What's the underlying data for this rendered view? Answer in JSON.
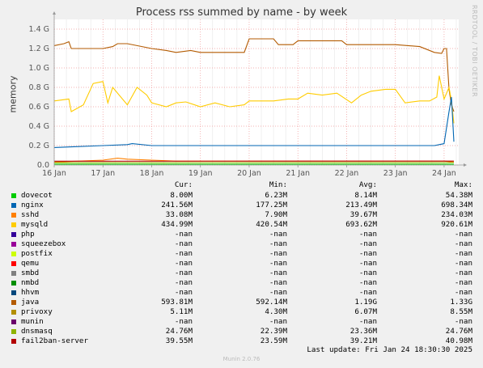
{
  "title": "Process rss summed by name - by week",
  "side_tag": "RRDTOOL / TOBI OETIKER",
  "footer": "Munin 2.0.76",
  "last_update": "Last update:  Fri Jan 24 18:30:30 2025",
  "headers": {
    "cur": "Cur:",
    "min": "Min:",
    "avg": "Avg:",
    "max": "Max:"
  },
  "legend": [
    {
      "name": "dovecot",
      "color": "#00cc00",
      "cur": "8.00M",
      "min": "6.23M",
      "avg": "8.14M",
      "max": "54.38M"
    },
    {
      "name": "nginx",
      "color": "#0066b3",
      "cur": "241.56M",
      "min": "177.25M",
      "avg": "213.49M",
      "max": "698.34M"
    },
    {
      "name": "sshd",
      "color": "#ff8000",
      "cur": "33.08M",
      "min": "7.90M",
      "avg": "39.67M",
      "max": "234.03M"
    },
    {
      "name": "mysqld",
      "color": "#ffcc00",
      "cur": "434.99M",
      "min": "420.54M",
      "avg": "693.62M",
      "max": "920.61M"
    },
    {
      "name": "php",
      "color": "#330099",
      "cur": "-nan",
      "min": "-nan",
      "avg": "-nan",
      "max": "-nan"
    },
    {
      "name": "squeezebox",
      "color": "#990099",
      "cur": "-nan",
      "min": "-nan",
      "avg": "-nan",
      "max": "-nan"
    },
    {
      "name": "postfix",
      "color": "#ccff00",
      "cur": "-nan",
      "min": "-nan",
      "avg": "-nan",
      "max": "-nan"
    },
    {
      "name": "qemu",
      "color": "#ff0000",
      "cur": "-nan",
      "min": "-nan",
      "avg": "-nan",
      "max": "-nan"
    },
    {
      "name": "smbd",
      "color": "#808080",
      "cur": "-nan",
      "min": "-nan",
      "avg": "-nan",
      "max": "-nan"
    },
    {
      "name": "nmbd",
      "color": "#008f00",
      "cur": "-nan",
      "min": "-nan",
      "avg": "-nan",
      "max": "-nan"
    },
    {
      "name": "hhvm",
      "color": "#00487d",
      "cur": "-nan",
      "min": "-nan",
      "avg": "-nan",
      "max": "-nan"
    },
    {
      "name": "java",
      "color": "#b35a00",
      "cur": "593.81M",
      "min": "592.14M",
      "avg": "1.19G",
      "max": "1.33G"
    },
    {
      "name": "privoxy",
      "color": "#b38f00",
      "cur": "5.11M",
      "min": "4.30M",
      "avg": "6.07M",
      "max": "8.55M"
    },
    {
      "name": "munin",
      "color": "#6b006b",
      "cur": "-nan",
      "min": "-nan",
      "avg": "-nan",
      "max": "-nan"
    },
    {
      "name": "dnsmasq",
      "color": "#8fb300",
      "cur": "24.76M",
      "min": "22.39M",
      "avg": "23.36M",
      "max": "24.76M"
    },
    {
      "name": "fail2ban-server",
      "color": "#b30000",
      "cur": "39.55M",
      "min": "23.59M",
      "avg": "39.21M",
      "max": "40.98M"
    }
  ],
  "chart_data": {
    "type": "line",
    "title": "Process rss summed by name - by week",
    "ylabel": "memory",
    "ylim": [
      0,
      1.5
    ],
    "y_unit": "G",
    "yticks": [
      0.0,
      0.2,
      0.4,
      0.6,
      0.8,
      1.0,
      1.2,
      1.4
    ],
    "ytick_labels": [
      "0.0",
      "0.2 G",
      "0.4 G",
      "0.6 G",
      "0.8 G",
      "1.0 G",
      "1.2 G",
      "1.4 G"
    ],
    "xlabels": [
      "16 Jan",
      "17 Jan",
      "18 Jan",
      "19 Jan",
      "20 Jan",
      "21 Jan",
      "22 Jan",
      "23 Jan",
      "24 Jan"
    ],
    "xlim": [
      0,
      8.3
    ],
    "grid": true,
    "series": [
      {
        "name": "java",
        "color": "#b35a00",
        "x": [
          0,
          0.2,
          0.3,
          0.35,
          0.5,
          1.0,
          1.2,
          1.3,
          1.5,
          2.0,
          2.3,
          2.5,
          2.8,
          3.0,
          3.3,
          3.6,
          3.9,
          4.0,
          4.5,
          4.6,
          4.9,
          5.0,
          5.5,
          5.9,
          6.0,
          6.5,
          7.0,
          7.5,
          7.8,
          7.95,
          8.0,
          8.05,
          8.1,
          8.15,
          8.2
        ],
        "y": [
          1.23,
          1.25,
          1.27,
          1.2,
          1.2,
          1.2,
          1.22,
          1.25,
          1.25,
          1.2,
          1.18,
          1.16,
          1.18,
          1.16,
          1.16,
          1.16,
          1.16,
          1.3,
          1.3,
          1.24,
          1.24,
          1.28,
          1.28,
          1.28,
          1.24,
          1.24,
          1.24,
          1.22,
          1.16,
          1.15,
          1.2,
          1.2,
          0.78,
          0.62,
          0.55
        ]
      },
      {
        "name": "mysqld",
        "color": "#ffcc00",
        "x": [
          0,
          0.3,
          0.35,
          0.6,
          0.8,
          1.0,
          1.1,
          1.2,
          1.5,
          1.7,
          1.9,
          2.0,
          2.3,
          2.5,
          2.7,
          3.0,
          3.3,
          3.6,
          3.9,
          4.0,
          4.5,
          4.8,
          5.0,
          5.2,
          5.5,
          5.8,
          6.1,
          6.3,
          6.5,
          6.8,
          7.0,
          7.2,
          7.5,
          7.7,
          7.85,
          7.9,
          8.0,
          8.1,
          8.15,
          8.2
        ],
        "y": [
          0.66,
          0.68,
          0.55,
          0.62,
          0.84,
          0.86,
          0.64,
          0.8,
          0.62,
          0.8,
          0.72,
          0.64,
          0.6,
          0.64,
          0.65,
          0.6,
          0.64,
          0.6,
          0.62,
          0.66,
          0.66,
          0.68,
          0.68,
          0.74,
          0.72,
          0.74,
          0.64,
          0.72,
          0.76,
          0.78,
          0.78,
          0.64,
          0.66,
          0.66,
          0.7,
          0.92,
          0.68,
          0.8,
          0.66,
          0.43
        ]
      },
      {
        "name": "nginx",
        "color": "#0066b3",
        "x": [
          0,
          0.5,
          1.0,
          1.5,
          1.6,
          2.0,
          2.5,
          3.0,
          3.5,
          4.0,
          4.5,
          5.0,
          5.5,
          6.0,
          6.5,
          7.0,
          7.5,
          7.8,
          8.0,
          8.1,
          8.15,
          8.2
        ],
        "y": [
          0.18,
          0.19,
          0.2,
          0.21,
          0.22,
          0.2,
          0.2,
          0.2,
          0.2,
          0.2,
          0.2,
          0.2,
          0.2,
          0.2,
          0.2,
          0.2,
          0.2,
          0.2,
          0.22,
          0.55,
          0.7,
          0.24
        ]
      },
      {
        "name": "sshd",
        "color": "#ff8000",
        "x": [
          0,
          0.5,
          1.0,
          1.3,
          1.5,
          2.0,
          2.5,
          3.0,
          4.0,
          5.0,
          6.0,
          7.0,
          8.0,
          8.2
        ],
        "y": [
          0.03,
          0.04,
          0.05,
          0.07,
          0.06,
          0.05,
          0.04,
          0.04,
          0.04,
          0.04,
          0.04,
          0.04,
          0.04,
          0.03
        ]
      },
      {
        "name": "fail2ban-server",
        "color": "#b30000",
        "x": [
          0,
          8.2
        ],
        "y": [
          0.039,
          0.04
        ]
      },
      {
        "name": "dnsmasq",
        "color": "#8fb300",
        "x": [
          0,
          8.2
        ],
        "y": [
          0.023,
          0.025
        ]
      },
      {
        "name": "dovecot",
        "color": "#00cc00",
        "x": [
          0,
          8.2
        ],
        "y": [
          0.008,
          0.008
        ]
      }
    ]
  }
}
